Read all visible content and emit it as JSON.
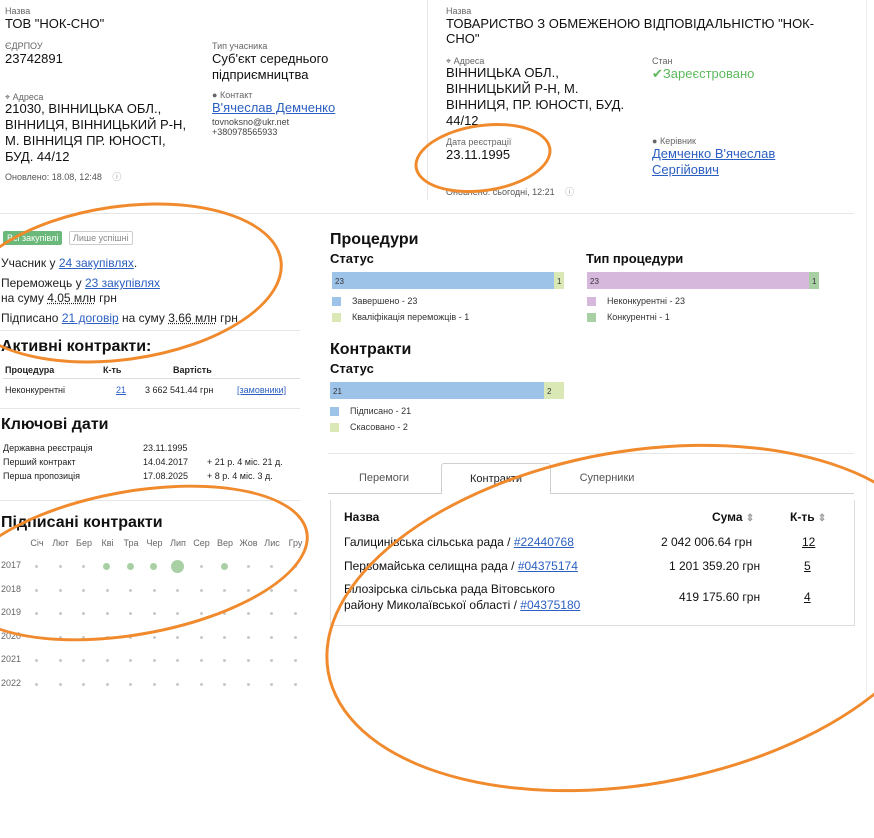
{
  "company": {
    "name_label": "Назва",
    "name": "ТОВ \"НОК-СНО\"",
    "edrpou_label": "ЄДРПОУ",
    "edrpou": "23742891",
    "type_label": "Тип учасника",
    "type_line1": "Суб'єкт середнього",
    "type_line2": "підприємництва",
    "address_label": "Адреса",
    "address_lines": [
      "21030, ВІННИЦЬКА ОБЛ.,",
      "ВІННИЦЯ, ВІННИЦЬКИЙ Р-Н,",
      "М. ВІННИЦЯ ПР. ЮНОСТІ,",
      "БУД. 44/12"
    ],
    "contact_label": "Контакт",
    "contact_name": "В'ячеслав Демченко",
    "contact_email": "tovnoksno@ukr.net",
    "contact_phone": "+380978565933",
    "updated": "Оновлено: 18.08, 12:48"
  },
  "registry": {
    "name_label": "Назва",
    "name_line1": "ТОВАРИСТВО З ОБМЕЖЕНОЮ ВІДПОВІДАЛЬНІСТЮ \"НОК-",
    "name_line2": "СНО\"",
    "address_label": "Адреса",
    "address_lines": [
      "ВІННИЦЬКА ОБЛ.,",
      "ВІННИЦЬКИЙ Р-Н, М.",
      "ВІННИЦЯ, ПР. ЮНОСТІ, БУД.",
      "44/12"
    ],
    "state_label": "Стан",
    "state": "Зареєстровано",
    "regdate_label": "Дата реєстрації",
    "regdate": "23.11.1995",
    "head_label": "Керівник",
    "head_line1": "Демченко В'ячеслав",
    "head_line2": "Сергійович",
    "updated": "Оновлено: сьогодні, 12:21"
  },
  "filters": {
    "all": "Всі закупівлі",
    "successful": "Лише успішні"
  },
  "stats": {
    "participant_prefix": "Учасник у",
    "participant_link": "24 закупівлях",
    "winner_prefix": "Переможець у",
    "winner_link": "23 закупівлях",
    "sum_prefix": "на суму",
    "sum_value": "4.05 млн",
    "currency": "грн",
    "signed_prefix": "Підписано",
    "signed_link": "21 договір",
    "signed_sum_value": "3.66 млн",
    "signed_sum_currency": "грн"
  },
  "active_contracts": {
    "title": "Активні контракти:",
    "headers": [
      "Процедура",
      "К-ть",
      "Вартість"
    ],
    "row": {
      "procedure": "Неконкурентні",
      "count": "21",
      "value": "3 662 541.44 грн",
      "link": "[замовники]"
    }
  },
  "key_dates": {
    "title": "Ключові дати",
    "rows": [
      {
        "label": "Державна реєстрація",
        "date": "23.11.1995",
        "delta": ""
      },
      {
        "label": "Перший контракт",
        "date": "14.04.2017",
        "delta": "+ 21 р. 4 міс. 21 д."
      },
      {
        "label": "Перша пропозиція",
        "date": "17.08.2025",
        "delta": "+ 8 р. 4 міс. 3 д."
      }
    ]
  },
  "signed_contracts": {
    "title": "Підписані контракти",
    "months": [
      "Січ",
      "Лют",
      "Бер",
      "Кві",
      "Тра",
      "Чер",
      "Лип",
      "Сер",
      "Вер",
      "Жов",
      "Лис",
      "Гру"
    ],
    "years": [
      "2017",
      "2018",
      "2019",
      "2020",
      "2021",
      "2022"
    ]
  },
  "procedures": {
    "title": "Процедури",
    "status_title": "Статус",
    "type_title": "Тип процедури"
  },
  "contracts": {
    "title": "Контракти",
    "status_title": "Статус"
  },
  "chart_data": [
    {
      "type": "bar",
      "title": "Статус",
      "series": [
        {
          "name": "Завершено - 23",
          "values": [
            23
          ],
          "color": "#9ec3e8"
        },
        {
          "name": "Кваліфікація переможців - 1",
          "values": [
            1
          ],
          "color": "#d9e8b5"
        }
      ]
    },
    {
      "type": "bar",
      "title": "Тип процедури",
      "series": [
        {
          "name": "Неконкурентні - 23",
          "values": [
            23
          ],
          "color": "#d6b8dc"
        },
        {
          "name": "Конкурентні - 1",
          "values": [
            1
          ],
          "color": "#a9cfa4"
        }
      ]
    },
    {
      "type": "bar",
      "title": "Статус",
      "series": [
        {
          "name": "Підписано - 21",
          "values": [
            21
          ],
          "color": "#9ec3e8"
        },
        {
          "name": "Скасовано - 2",
          "values": [
            2
          ],
          "color": "#d9e8b5"
        }
      ]
    },
    {
      "type": "scatter",
      "title": "Підписані контракти",
      "x": [
        "Кві",
        "Тра",
        "Чер",
        "Лип",
        "Вер"
      ],
      "y": [
        "2017",
        "2017",
        "2017",
        "2017",
        "2017"
      ],
      "size": [
        1,
        1,
        1,
        3,
        1
      ]
    }
  ],
  "tabs": [
    "Перемоги",
    "Контракти",
    "Суперники"
  ],
  "table": {
    "headers": {
      "name": "Назва",
      "sum": "Сума",
      "count": "К-ть"
    },
    "rows": [
      {
        "name": "Галицинівська сільська рада /",
        "code": "#22440768",
        "name2": "",
        "sum": "2 042 006.64 грн",
        "count": "12"
      },
      {
        "name": "Первомайська селищна рада /",
        "code": "#04375174",
        "name2": "",
        "sum": "1 201 359.20 грн",
        "count": "5"
      },
      {
        "name": "Білозірська сільська рада Вітовського",
        "code": "#04375180",
        "name2": "району Миколаївської області /",
        "sum": "419 175.60 грн",
        "count": "4"
      }
    ]
  }
}
